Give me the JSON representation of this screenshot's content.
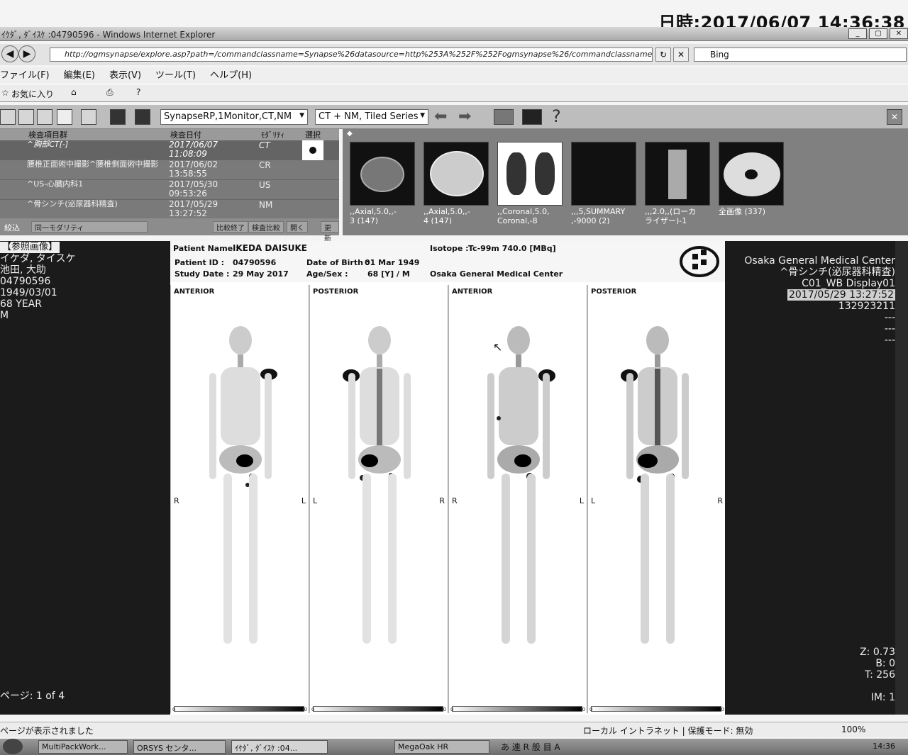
{
  "stamp": "日時:2017/06/07 14:36:38",
  "window": {
    "title": "ｲｹﾀﾞ, ﾀﾞｲｽｹ :04790596 - Windows Internet Explorer",
    "minimize": "_",
    "restore": "▢",
    "close": "✕"
  },
  "browser": {
    "url": "http://ogmsynapse/explore.asp?path=/commandclassname=Synapse%26datasource=http%253A%252F%252Fogmsynapse%26/commandclassname=StudyList1",
    "search_placeholder": "Bing",
    "menu": [
      "ファイル(F)",
      "編集(E)",
      "表示(V)",
      "ツール(T)",
      "ヘルプ(H)"
    ],
    "favorites": "お気に入り"
  },
  "app_toolbar": {
    "layout_select": "SynapseRP,1Monitor,CT,NM",
    "series_select": "CT + NM, Tiled Series"
  },
  "studylist": {
    "headers": [
      "検査項目群",
      "検査日付",
      "ﾓﾀﾞﾘﾃｨ",
      "選択"
    ],
    "rows": [
      {
        "name": "^胸部CT[-]",
        "date": "2017/06/07",
        "time": "11:08:09",
        "modality": "CT"
      },
      {
        "name": "腰椎正面術中撮影^腰椎側面術中撮影",
        "date": "2017/06/02",
        "time": "13:58:55",
        "modality": "CR"
      },
      {
        "name": "^US-心臓内科1",
        "date": "2017/05/30",
        "time": "09:53:26",
        "modality": "US"
      },
      {
        "name": "^骨シンチ(泌尿器科精査)",
        "date": "2017/05/29",
        "time": "13:27:52",
        "modality": "NM"
      }
    ],
    "footer": {
      "filter": "絞込",
      "filter_value": "同一モダリティ",
      "btn1": "比較終了",
      "btn2": "検査比較",
      "btn3": "開く",
      "btn4": "更新"
    }
  },
  "thumbnails": [
    {
      "label": ",,Axial,5.0,,-\n3 (147)"
    },
    {
      "label": ",,Axial,5.0,,-\n4 (147)"
    },
    {
      "label": ",,Coronal,5.0,\nCoronal,-8"
    },
    {
      "label": ",,,5,SUMMARY\n,-9000 (2)"
    },
    {
      "label": ",,,2.0,,(ローカ\nライザー)-1"
    },
    {
      "label": "全画像 (337)"
    }
  ],
  "left_info": {
    "ref_label": "【参照画像】",
    "name_kana": "イケダ, タイスケ",
    "name_kanji": "池田, 大助",
    "patient_id": "04790596",
    "dob": "1949/03/01",
    "age": "68 YEAR",
    "sex": "M",
    "page": "ページ: 1 of 4"
  },
  "right_info": {
    "institution": "Osaka General Medical Center",
    "exam": "^骨シンチ(泌尿器科精査)",
    "display": "C01_WB Display01",
    "datetime": "2017/05/29 13:27:52",
    "accession": "132923211",
    "dash1": "---",
    "dash2": "---",
    "dash3": "---",
    "zoom": "Z: 0.73",
    "brightness": "B: 0",
    "threshold": "T: 256",
    "im": "IM: 1"
  },
  "scan_header": {
    "patient_name_label": "Patient Name :",
    "patient_name": "IKEDA DAISUKE",
    "isotope_label": "Isotope :",
    "isotope": "Tc-99m   740.0 [MBq]",
    "patient_id_label": "Patient ID :",
    "patient_id": "04790596",
    "dob_label": "Date of Birth :",
    "dob": "01 Mar 1949",
    "study_date_label": "Study Date :",
    "study_date": "29 May 2017",
    "agesex_label": "Age/Sex :",
    "agesex": "68 [Y] / M",
    "institution": "Osaka General Medical Center"
  },
  "views": [
    {
      "label": "ANTERIOR",
      "left_mark": "R",
      "right_mark": "L",
      "scale_max": "150"
    },
    {
      "label": "POSTERIOR",
      "left_mark": "L",
      "right_mark": "R",
      "scale_max": "150"
    },
    {
      "label": "ANTERIOR",
      "left_mark": "R",
      "right_mark": "L",
      "scale_max": "70"
    },
    {
      "label": "POSTERIOR",
      "left_mark": "L",
      "right_mark": "R",
      "scale_max": "70"
    }
  ],
  "scale_min": "0",
  "status": {
    "left": "ページが表示されました",
    "zone": "ローカル イントラネット | 保護モード: 無効",
    "zoom": "100%"
  },
  "taskbar": {
    "items": [
      "MultiPackWork...",
      "ORSYS センタ...",
      "ｲｹﾀﾞ, ﾀﾞｲｽｹ :04...",
      "MegaOak HR"
    ],
    "ime": "あ 連 R 般 目 A",
    "clock": "14:36"
  }
}
